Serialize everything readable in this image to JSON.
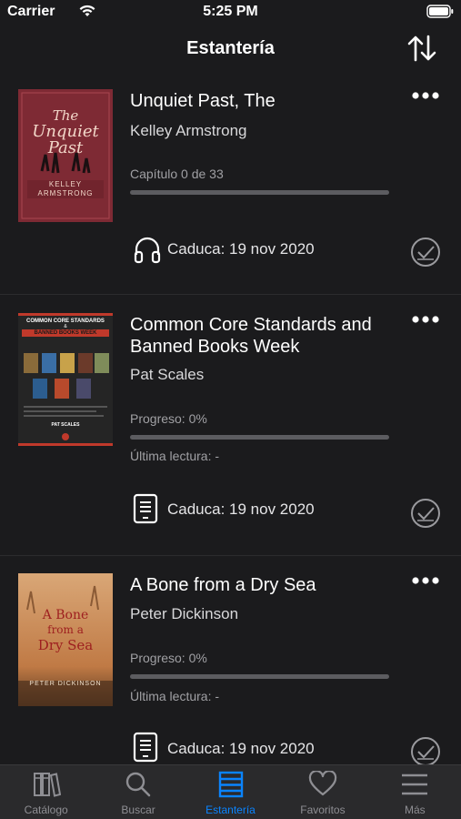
{
  "status_bar": {
    "carrier": "Carrier",
    "time": "5:25 PM"
  },
  "nav": {
    "title": "Estantería"
  },
  "books": [
    {
      "title": "Unquiet Past, The",
      "author": "Kelley Armstrong",
      "progress_label": "Capítulo 0 de 33",
      "progress": 0,
      "last_read": "",
      "format_icon": "headphones-icon",
      "expiry": "Caduca: 19 nov 2020",
      "cover": {
        "line1": "The",
        "line2": "Unquiet",
        "line3": "Past",
        "author": "KELLEY",
        "author2": "ARMSTRONG",
        "bg": "#8c2f3a"
      }
    },
    {
      "title": "Common Core Standards and Banned Books Week",
      "author": "Pat Scales",
      "progress_label": "Progreso: 0%",
      "progress": 0,
      "last_read": "Última lectura: -",
      "format_icon": "ebook-icon",
      "expiry": "Caduca: 19 nov 2020",
      "cover": {
        "line1": "COMMON CORE STANDARDS",
        "line2": "&",
        "line3": "BANNED BOOKS WEEK",
        "author": "PAT SCALES",
        "bg": "#2a2a2a"
      }
    },
    {
      "title": "A Bone from a Dry Sea",
      "author": "Peter Dickinson",
      "progress_label": "Progreso: 0%",
      "progress": 0,
      "last_read": "Última lectura: -",
      "format_icon": "ebook-icon",
      "expiry": "Caduca: 19 nov 2020",
      "cover": {
        "line1": "A Bone",
        "line2": "from a",
        "line3": "Dry Sea",
        "author": "PETER DICKINSON",
        "bg": "#c98a55"
      }
    }
  ],
  "tabs": [
    {
      "label": "Catálogo",
      "icon": "books-icon",
      "active": false
    },
    {
      "label": "Buscar",
      "icon": "search-icon",
      "active": false
    },
    {
      "label": "Estantería",
      "icon": "shelf-icon",
      "active": true
    },
    {
      "label": "Favoritos",
      "icon": "heart-icon",
      "active": false
    },
    {
      "label": "Más",
      "icon": "menu-icon",
      "active": false
    }
  ],
  "colors": {
    "accent": "#0a84ff",
    "background": "#1b1b1d",
    "tab_bar": "#2a2a2c"
  }
}
